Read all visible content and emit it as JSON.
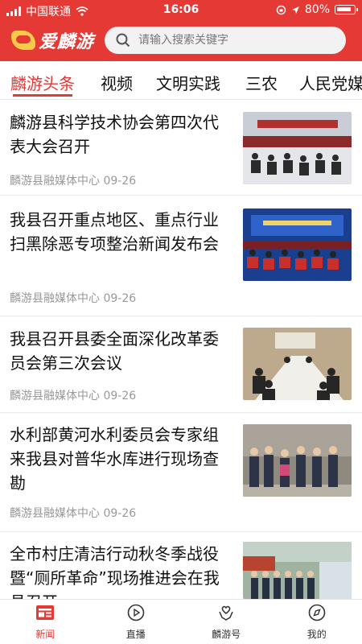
{
  "status_bar": {
    "carrier": "中国联通",
    "time": "16:06",
    "battery": "80%"
  },
  "header": {
    "logo_text": "爱麟游",
    "search_placeholder": "请输入搜索关键字"
  },
  "tabs": [
    "麟游头条",
    "视频",
    "文明实践",
    "三农",
    "人民党媒"
  ],
  "active_tab": 0,
  "news": [
    {
      "title": "麟游县科学技术协会第四次代表大会召开",
      "source": "麟游县融媒体中心",
      "date": "09-26",
      "thumb": "conference-hall"
    },
    {
      "title": "我县召开重点地区、重点行业扫黑除恶专项整治新闻发布会",
      "source": "麟游县融媒体中心",
      "date": "09-26",
      "thumb": "press-conference"
    },
    {
      "title": "我县召开县委全面深化改革委员会第三次会议",
      "source": "麟游县融媒体中心",
      "date": "09-26",
      "thumb": "meeting-table"
    },
    {
      "title": "水利部黄河水利委员会专家组来我县对普华水库进行现场查勘",
      "source": "麟游县融媒体中心",
      "date": "09-26",
      "thumb": "outdoor-group"
    },
    {
      "title": "全市村庄清洁行动秋冬季战役暨“厕所革命”现场推进会在我县召开",
      "source": "",
      "date": "",
      "thumb": "village-group"
    }
  ],
  "bottom_nav": [
    {
      "label": "新闻",
      "icon": "news-icon",
      "active": true
    },
    {
      "label": "直播",
      "icon": "play-icon",
      "active": false
    },
    {
      "label": "麟游号",
      "icon": "heart-hands-icon",
      "active": false
    },
    {
      "label": "我的",
      "icon": "compass-icon",
      "active": false
    }
  ],
  "colors": {
    "accent": "#e53935",
    "meta_text": "#999999"
  }
}
